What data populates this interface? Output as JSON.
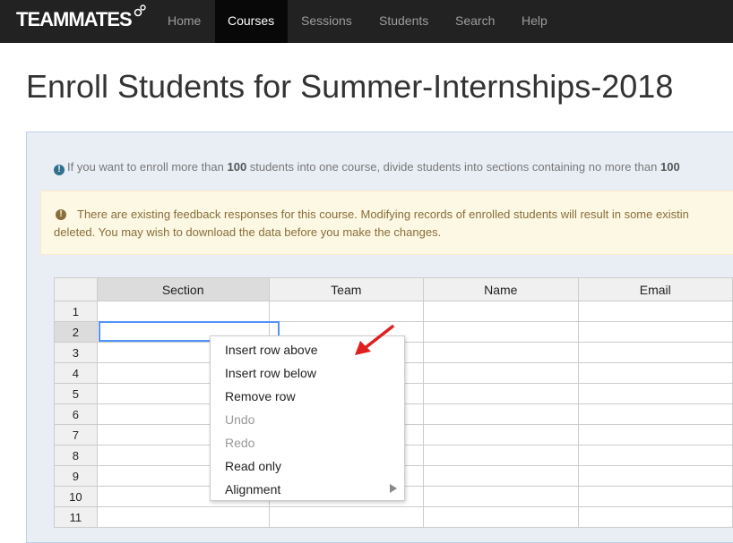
{
  "nav": {
    "brand": "TEAMMATES",
    "items": [
      "Home",
      "Courses",
      "Sessions",
      "Students",
      "Search",
      "Help"
    ],
    "active": "Courses"
  },
  "page": {
    "title": "Enroll Students for Summer-Internships-2018"
  },
  "info": {
    "text_before": "If you want to enroll more than ",
    "bold_1": "100",
    "text_middle": " students into one course, divide students into sections containing no more than ",
    "bold_2": "100"
  },
  "warning": {
    "line1": "There are existing feedback responses for this course. Modifying records of enrolled students will result in some existin",
    "line2": "deleted. You may wish to download the data before you make the changes."
  },
  "grid": {
    "columns": [
      "Section",
      "Team",
      "Name",
      "Email"
    ],
    "rows": [
      "1",
      "2",
      "3",
      "4",
      "5",
      "6",
      "7",
      "8",
      "9",
      "10",
      "11"
    ]
  },
  "context_menu": {
    "items": [
      {
        "label": "Insert row above",
        "enabled": true
      },
      {
        "label": "Insert row below",
        "enabled": true
      },
      {
        "label": "Remove row",
        "enabled": true
      },
      {
        "label": "Undo",
        "enabled": false
      },
      {
        "label": "Redo",
        "enabled": false
      },
      {
        "label": "Read only",
        "enabled": true
      },
      {
        "label": "Alignment",
        "enabled": true
      }
    ]
  },
  "colors": {
    "navbar": "#222222",
    "selection": "#5292f7",
    "arrow": "#e02020"
  }
}
